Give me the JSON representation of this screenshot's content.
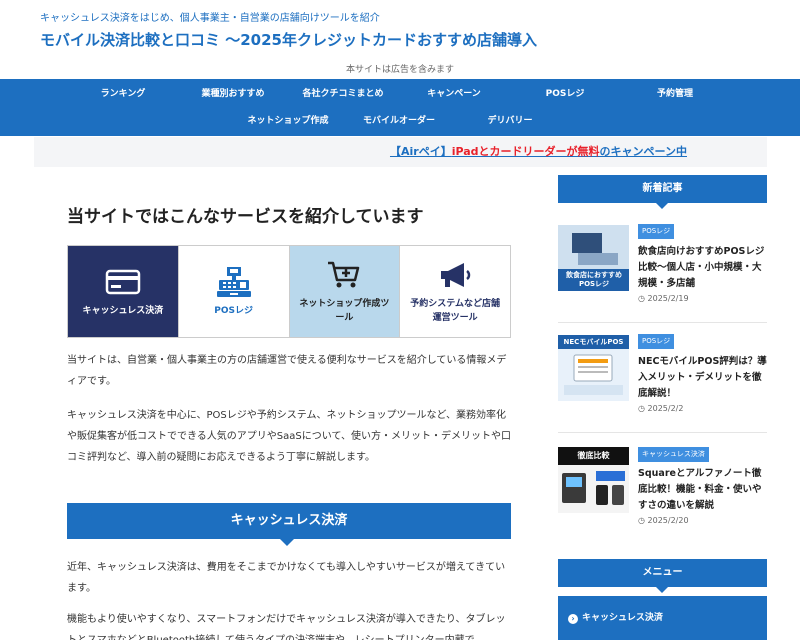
{
  "header": {
    "tagline": "キャッシュレス決済をはじめ、個人事業主・自営業の店舗向けツールを紹介",
    "site_title": "モバイル決済比較と口コミ 〜2025年クレジットカードおすすめ店舗導入",
    "ad_note": "本サイトは広告を含みます"
  },
  "nav": {
    "row1": [
      "ランキング",
      "業種別おすすめ",
      "各社クチコミまとめ",
      "キャンペーン",
      "POSレジ",
      "予約管理"
    ],
    "row2": [
      "ネットショップ作成",
      "モバイルオーダー",
      "デリバリー"
    ]
  },
  "campaign": {
    "part1": "【Airペイ】",
    "part2": "iPadとカードリーダーが無料",
    "part3": "のキャンペーン中"
  },
  "main": {
    "heading": "当サイトではこんなサービスを紹介しています",
    "services": [
      {
        "label": "キャッシュレス決済",
        "icon": "credit-card-icon"
      },
      {
        "label": "POSレジ",
        "icon": "cash-register-icon"
      },
      {
        "label": "ネットショップ作成ツール",
        "icon": "shopping-cart-icon"
      },
      {
        "label": "予約システムなど店舗運営ツール",
        "icon": "megaphone-icon"
      }
    ],
    "intro1": "当サイトは、自営業・個人事業主の方の店舗運営で使える便利なサービスを紹介している情報メディアです。",
    "intro2": "キャッシュレス決済を中心に、POSレジや予約システム、ネットショップツールなど、業務効率化や販促集客が低コストでできる人気のアプリやSaaSについて、使い方・メリット・デメリットや口コミ評判など、導入前の疑問にお応えできるよう丁寧に解説します。",
    "section_title": "キャッシュレス決済",
    "body1": "近年、キャッシュレス決済は、費用をそこまでかけなくても導入しやすいサービスが増えてきています。",
    "body2": "機能もより使いやすくなり、スマートフォンだけでキャッシュレス決済が導入できたり、タブレットとスマホなどとBluetooth接続して使うタイプの決済端末や、レシートプリンター内蔵で"
  },
  "sidebar": {
    "new_articles_title": "新着記事",
    "articles": [
      {
        "category": "POSレジ",
        "title": "飲食店向けおすすめPOSレジ比較〜個人店・小中規模・大規模・多店舗",
        "date": "2025/2/19",
        "thumb_text": "飲食店におすすめPOSレジ"
      },
      {
        "category": "POSレジ",
        "title": "NECモバイルPOS評判は？導入メリット・デメリットを徹底解説！",
        "date": "2025/2/2",
        "thumb_text": "NECモバイルPOS"
      },
      {
        "category": "キャッシュレス決済",
        "title": "Squareとアルファノート徹底比較！機能・料金・使いやすさの違いを解説",
        "date": "2025/2/20",
        "thumb_text": "徹底比較"
      }
    ],
    "menu_title": "メニュー",
    "menu_items": [
      "キャッシュレス決済"
    ]
  },
  "colors": {
    "accent": "#1d6fc0",
    "dark_navy": "#263266",
    "light_blue": "#b9d8ec",
    "campaign_red": "#e8212b"
  }
}
